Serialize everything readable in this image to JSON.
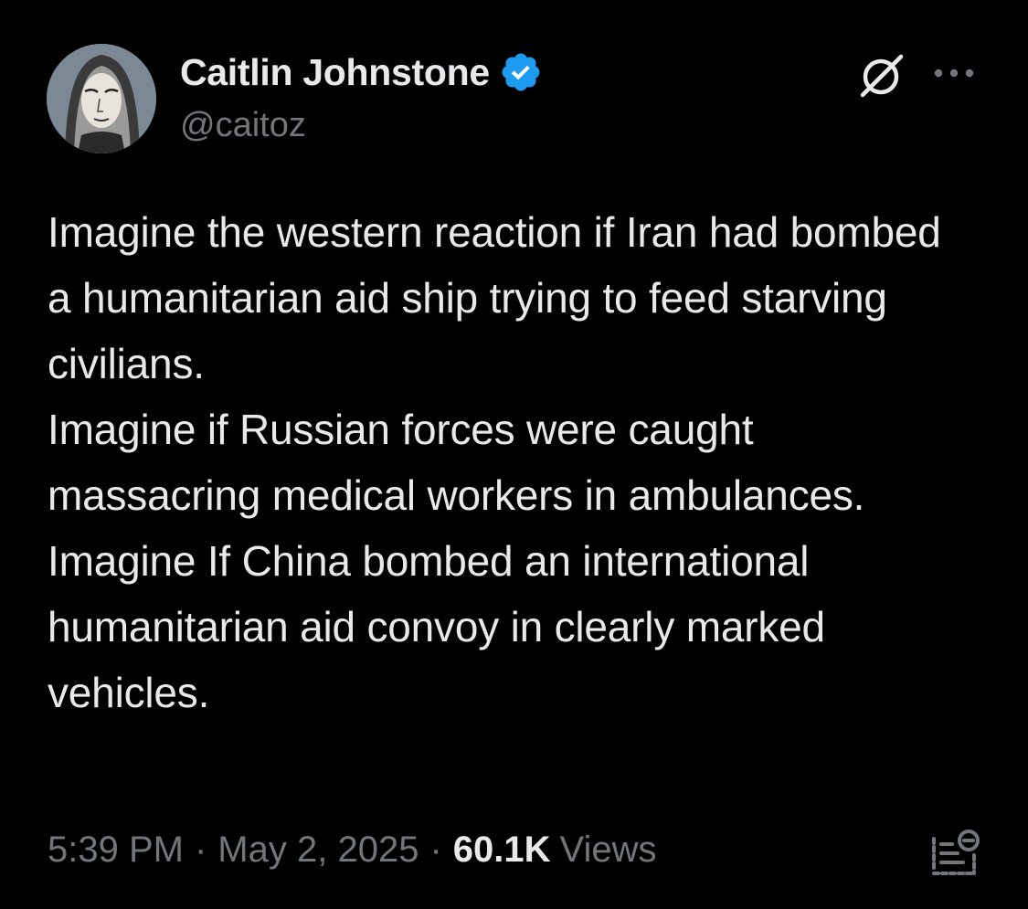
{
  "author": {
    "display_name": "Caitlin Johnstone",
    "handle": "@caitoz",
    "verified": true
  },
  "icons": {
    "verified": "verified-badge-icon",
    "grok": "grok-icon",
    "more": "more-options-icon",
    "analytics": "analytics-icon"
  },
  "colors": {
    "background": "#000000",
    "text": "#e7e9ea",
    "muted": "#71767b",
    "verified_blue": "#1d9bf0"
  },
  "tweet": {
    "paragraphs": [
      "Imagine the western reaction if Iran had bombed a humanitarian aid ship trying to feed starving civilians.",
      "Imagine if Russian forces were caught massacring medical workers in ambulances.",
      "Imagine If China bombed an international humanitarian aid convoy in clearly marked vehicles."
    ]
  },
  "meta": {
    "time": "5:39 PM",
    "separator": "·",
    "date": "May 2, 2025",
    "views_count": "60.1K",
    "views_label": "Views"
  }
}
